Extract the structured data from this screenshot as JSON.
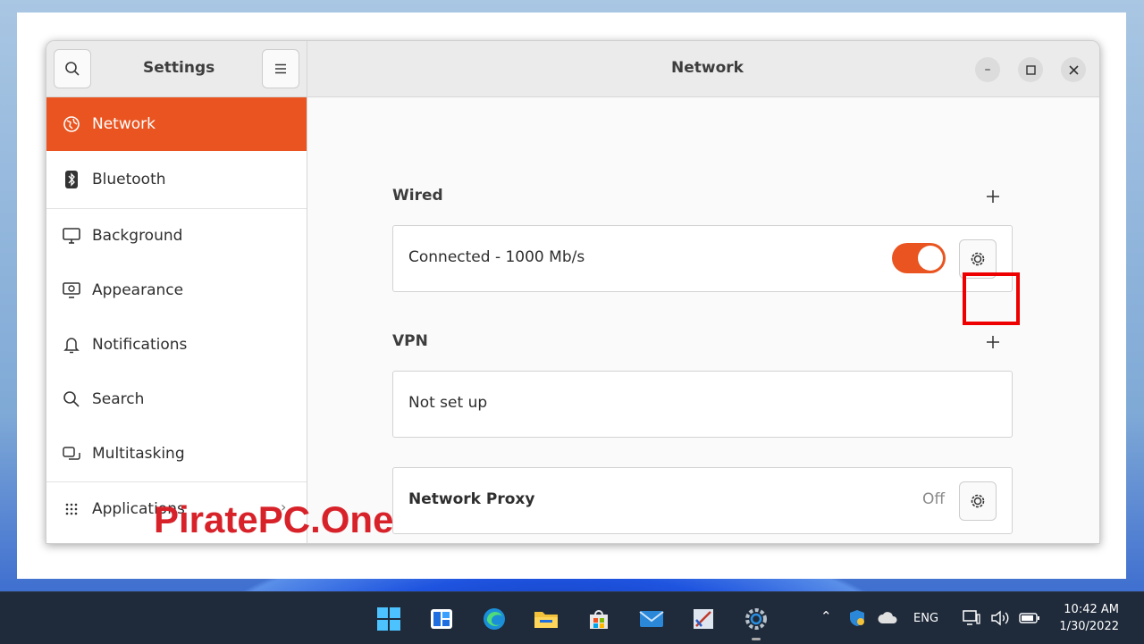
{
  "window": {
    "sidebar_title": "Settings",
    "main_title": "Network"
  },
  "sidebar": {
    "items": [
      {
        "label": "Network",
        "icon": "globe-icon",
        "active": true
      },
      {
        "label": "Bluetooth",
        "icon": "bluetooth-icon"
      },
      {
        "label": "Background",
        "icon": "display-icon"
      },
      {
        "label": "Appearance",
        "icon": "appearance-icon"
      },
      {
        "label": "Notifications",
        "icon": "bell-icon"
      },
      {
        "label": "Search",
        "icon": "search-icon"
      },
      {
        "label": "Multitasking",
        "icon": "multitasking-icon"
      },
      {
        "label": "Applications",
        "icon": "grid-icon"
      }
    ]
  },
  "wired": {
    "label": "Wired",
    "status": "Connected - 1000 Mb/s",
    "enabled": true
  },
  "vpn": {
    "label": "VPN",
    "status": "Not set up"
  },
  "proxy": {
    "label": "Network Proxy",
    "status": "Off"
  },
  "watermark": "PiratePC.One",
  "taskbar": {
    "language": "ENG",
    "time": "10:42 AM",
    "date": "1/30/2022"
  },
  "colors": {
    "accent": "#e95420",
    "highlight": "#ee0000",
    "watermark": "#d8222a"
  }
}
